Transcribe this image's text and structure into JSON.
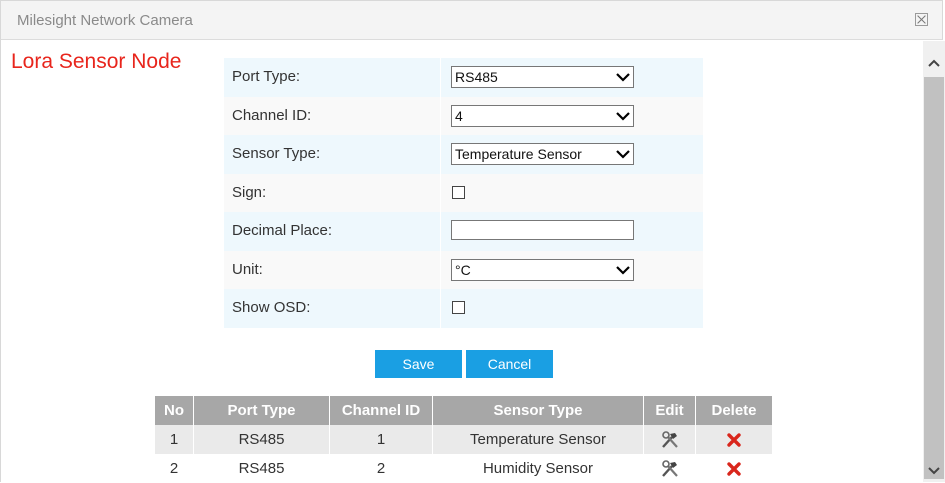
{
  "window": {
    "title": "Milesight Network Camera"
  },
  "heading": "Lora Sensor Node",
  "form": {
    "port_type": {
      "label": "Port Type:",
      "value": "RS485"
    },
    "channel_id": {
      "label": "Channel ID:",
      "value": "4"
    },
    "sensor_type": {
      "label": "Sensor Type:",
      "value": "Temperature Sensor"
    },
    "sign": {
      "label": "Sign:"
    },
    "decimal_place": {
      "label": "Decimal Place:",
      "value": ""
    },
    "unit": {
      "label": "Unit:",
      "value": "°C"
    },
    "show_osd": {
      "label": "Show OSD:"
    }
  },
  "buttons": {
    "save": "Save",
    "cancel": "Cancel"
  },
  "table": {
    "headers": {
      "no": "No",
      "port_type": "Port Type",
      "channel_id": "Channel ID",
      "sensor_type": "Sensor Type",
      "edit": "Edit",
      "delete": "Delete"
    },
    "rows": [
      {
        "no": "1",
        "port_type": "RS485",
        "channel_id": "1",
        "sensor_type": "Temperature Sensor"
      },
      {
        "no": "2",
        "port_type": "RS485",
        "channel_id": "2",
        "sensor_type": "Humidity Sensor"
      }
    ]
  },
  "icons": {
    "close": "close-icon",
    "edit": "wrench-hammer-icon",
    "delete": "red-x-icon"
  },
  "colors": {
    "accent": "#1a9fe3",
    "heading": "#e8251c",
    "delete": "#d9261c"
  }
}
